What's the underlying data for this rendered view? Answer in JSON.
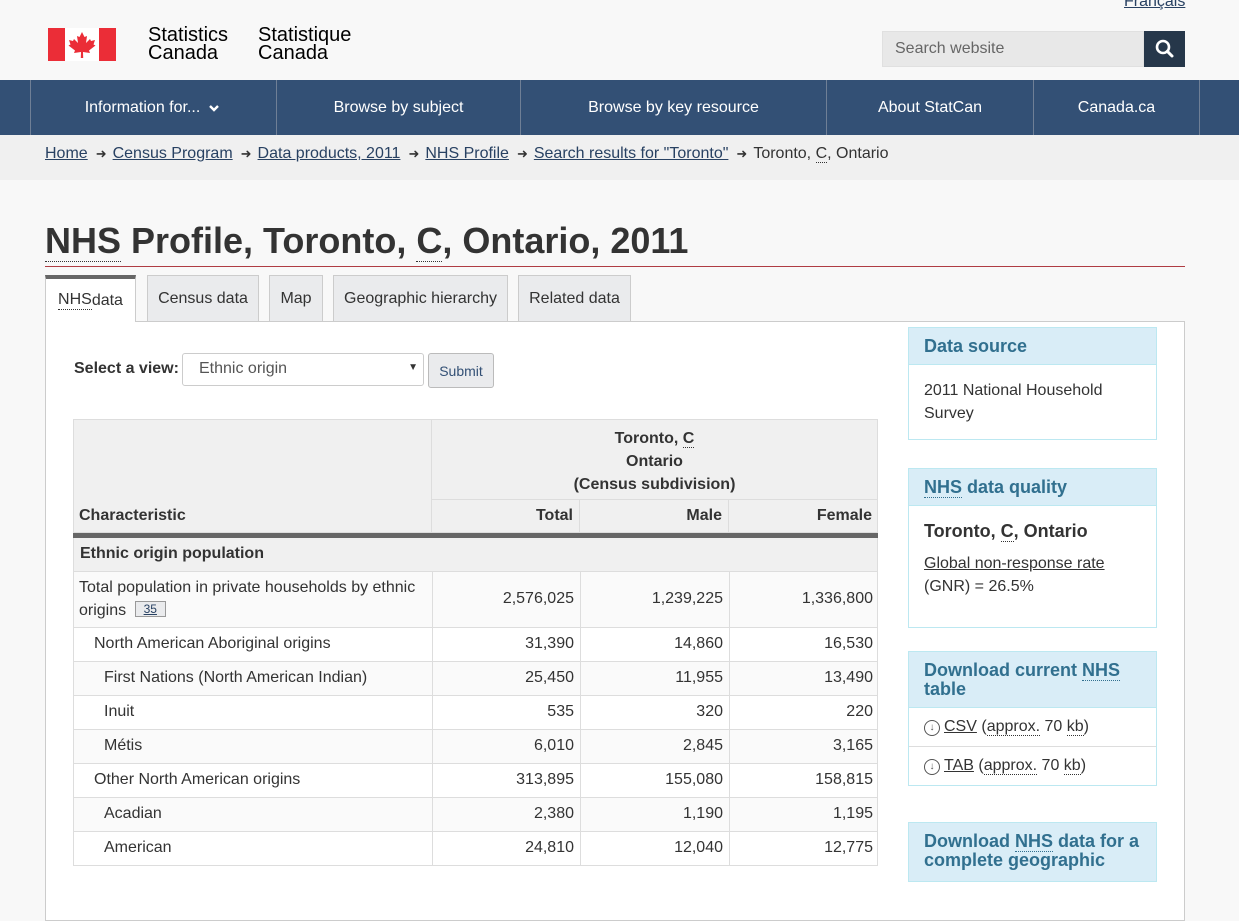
{
  "header": {
    "language_link": "Français",
    "signature_en_line1": "Statistics",
    "signature_en_line2": "Canada",
    "signature_fr_line1": "Statistique",
    "signature_fr_line2": "Canada",
    "search_placeholder": "Search website"
  },
  "nav": {
    "items": [
      {
        "label": "Information for..."
      },
      {
        "label": "Browse by subject"
      },
      {
        "label": "Browse by key resource"
      },
      {
        "label": "About StatCan"
      },
      {
        "label": "Canada.ca"
      }
    ]
  },
  "breadcrumb": {
    "links": [
      "Home",
      "Census Program",
      "Data products, 2011",
      "NHS Profile",
      "Search results for \"Toronto\""
    ],
    "current_prefix": "Toronto, ",
    "current_abbr": "C",
    "current_suffix": ", Ontario"
  },
  "page": {
    "title_abbr": "NHS",
    "title_mid": " Profile, Toronto, ",
    "title_abbr2": "C",
    "title_end": ", Ontario, 2011"
  },
  "tabs": [
    {
      "label_abbr": "NHS",
      "label_rest": " data"
    },
    {
      "label": "Census data"
    },
    {
      "label": "Map"
    },
    {
      "label": "Geographic hierarchy"
    },
    {
      "label": "Related data"
    }
  ],
  "view_selector": {
    "label": "Select a view:",
    "selected": "Ethnic origin",
    "submit": "Submit"
  },
  "table": {
    "geo_line1_prefix": "Toronto, ",
    "geo_line1_abbr": "C",
    "geo_line2": "Ontario",
    "geo_line3": "(Census subdivision)",
    "col_characteristic": "Characteristic",
    "col_total": "Total",
    "col_male": "Male",
    "col_female": "Female",
    "section": "Ethnic origin population",
    "first_row_label_line1": "Total population in private households by ethnic",
    "first_row_label_line2": "origins",
    "first_row_footnote": "35",
    "first_row_total": "2,576,025",
    "first_row_male": "1,239,225",
    "first_row_female": "1,336,800",
    "rows": [
      {
        "label": "North American Aboriginal origins",
        "total": "31,390",
        "male": "14,860",
        "female": "16,530"
      },
      {
        "label": "First Nations (North American Indian)",
        "total": "25,450",
        "male": "11,955",
        "female": "13,490"
      },
      {
        "label": "Inuit",
        "total": "535",
        "male": "320",
        "female": "220"
      },
      {
        "label": "Métis",
        "total": "6,010",
        "male": "2,845",
        "female": "3,165"
      },
      {
        "label": "Other North American origins",
        "total": "313,895",
        "male": "155,080",
        "female": "158,815"
      },
      {
        "label": "Acadian",
        "total": "2,380",
        "male": "1,190",
        "female": "1,195"
      },
      {
        "label": "American",
        "total": "24,810",
        "male": "12,040",
        "female": "12,775"
      }
    ]
  },
  "sidebar": {
    "data_source_title": "Data source",
    "data_source_text": "2011 National Household Survey",
    "quality_title_abbr": "NHS",
    "quality_title_rest": " data quality",
    "quality_geo_prefix": "Toronto, ",
    "quality_geo_abbr": "C",
    "quality_geo_suffix": ", Ontario",
    "quality_link": "Global non-response rate",
    "quality_value": "(GNR) = 26.5%",
    "download_title_1": "Download current ",
    "download_title_abbr": "NHS",
    "download_title_2": "table",
    "csv_link": "CSV",
    "tab_link": "TAB",
    "approx_abbr": "approx.",
    "size": " 70 ",
    "kb_abbr": "kb",
    "download2_title_1": "Download ",
    "download2_title_abbr": "NHS",
    "download2_title_2": " data for a",
    "download2_title_3": "complete geographic"
  },
  "colors": {
    "nav_bg": "#335075",
    "search_button": "#26374a",
    "title_rule": "#af3c43",
    "sidebar_head": "#d9edf7",
    "sidebar_text": "#31708f",
    "flag_red": "#eb2d37"
  }
}
